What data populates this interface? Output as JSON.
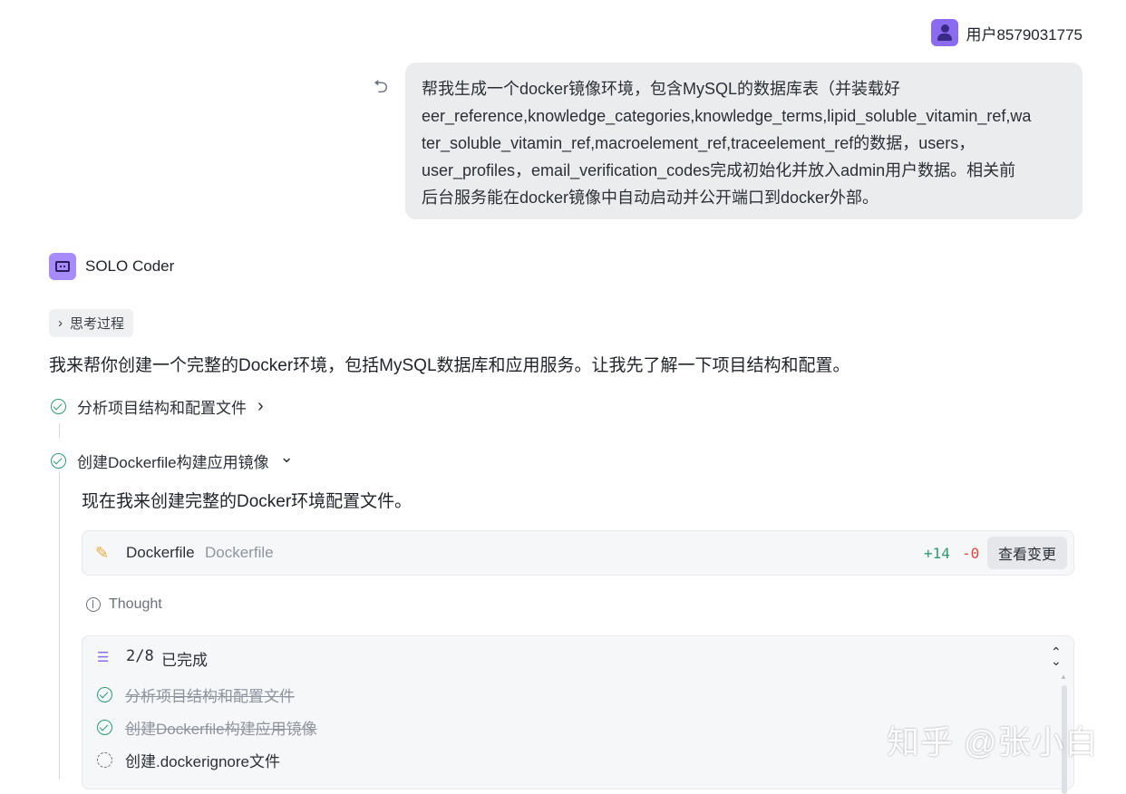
{
  "user": {
    "name": "用户8579031775",
    "message_lines": [
      "帮我生成一个docker镜像环境，包含MySQL的数据库表（并装载好",
      "eer_reference,knowledge_categories,knowledge_terms,lipid_soluble_vitamin_ref,wa",
      "ter_soluble_vitamin_ref,macroelement_ref,traceelement_ref的数据，users，",
      "user_profiles，email_verification_codes完成初始化并放入admin用户数据。相关前",
      "后台服务能在docker镜像中自动启动并公开端口到docker外部。"
    ]
  },
  "assistant": {
    "name": "SOLO Coder",
    "thinking_label": "思考过程",
    "intro": "我来帮你创建一个完整的Docker环境，包括MySQL数据库和应用服务。让我先了解一下项目结构和配置。",
    "steps": [
      {
        "label": "分析项目结构和配置文件",
        "chevron": "›"
      },
      {
        "label": "创建Dockerfile构建应用镜像",
        "chevron": "⌄"
      }
    ],
    "step2_text": "现在我来创建完整的Docker环境配置文件。",
    "file_change": {
      "name": "Dockerfile",
      "path": "Dockerfile",
      "additions": "+14",
      "deletions": "-0",
      "view_button": "查看变更"
    },
    "thought_label": "Thought",
    "todo": {
      "count": "2/8",
      "status": "已完成",
      "items": [
        {
          "label": "分析项目结构和配置文件",
          "state": "done"
        },
        {
          "label": "创建Dockerfile构建应用镜像",
          "state": "done"
        },
        {
          "label": "创建.dockerignore文件",
          "state": "in-progress"
        }
      ]
    }
  },
  "watermark": "知乎 @张小白",
  "colors": {
    "accent": "#8b6cf0",
    "success": "#2f9a6f",
    "danger": "#e0453b",
    "bubble": "#ebecee"
  }
}
